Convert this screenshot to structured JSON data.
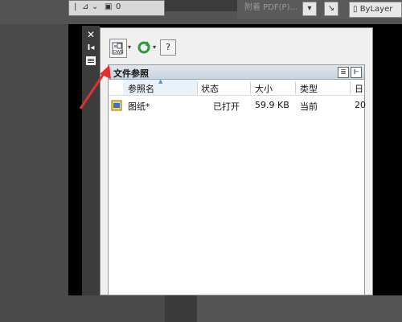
{
  "background": {
    "top_menu_text": "附着 PDF(P)...",
    "layer_combo": "ByLayer"
  },
  "palette": {
    "side_buttons": [
      "close-icon",
      "autohide-icon",
      "properties-icon"
    ],
    "toolbar": {
      "attach_button_icon": "attach-dwg-icon",
      "refresh_button_icon": "refresh-icon",
      "help_button_icon": "help-icon"
    },
    "file_references": {
      "title": "文件参照",
      "columns": [
        "参照名",
        "状态",
        "大小",
        "类型",
        "日"
      ],
      "rows": [
        {
          "name": "图纸*",
          "status": "已打开",
          "size": "59.9 KB",
          "type": "当前",
          "date": "20"
        }
      ]
    }
  },
  "colors": {
    "annotation_arrow": "#e03030",
    "header_gradient": "#c9d3de"
  }
}
